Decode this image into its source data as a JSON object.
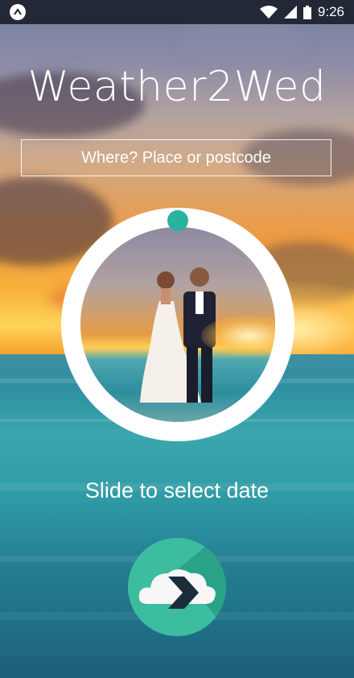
{
  "status_bar": {
    "app_icon": "android-notification-icon",
    "wifi_icon": "wifi-icon",
    "signal_icon": "signal-icon",
    "battery_icon": "battery-icon",
    "time": "9:26"
  },
  "app": {
    "title": "Weather2Wed"
  },
  "search": {
    "placeholder": "Where? Place or postcode",
    "value": ""
  },
  "date_dial": {
    "handle_color": "#27b39c",
    "ring_color": "#ffffff",
    "photo_description": "wedding-couple-beach-sunset"
  },
  "slide_label": "Slide to select date",
  "go_button": {
    "icon": "cloud-arrow-icon",
    "color": "#3dbd9f"
  }
}
